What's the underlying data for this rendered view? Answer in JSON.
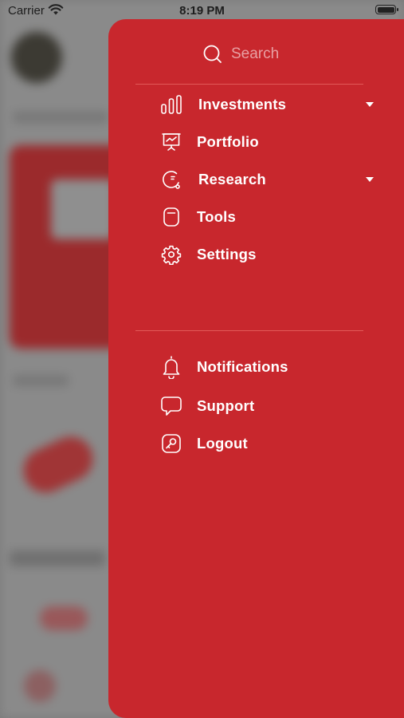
{
  "status_bar": {
    "carrier": "Carrier",
    "time": "8:19 PM"
  },
  "drawer": {
    "search": {
      "placeholder": "Search"
    },
    "menu": [
      {
        "label": "Investments",
        "icon": "bar-chart-icon",
        "expandable": true
      },
      {
        "label": "Portfolio",
        "icon": "presentation-icon",
        "expandable": false
      },
      {
        "label": "Research",
        "icon": "research-icon",
        "expandable": true
      },
      {
        "label": "Tools",
        "icon": "tools-icon",
        "expandable": false
      },
      {
        "label": "Settings",
        "icon": "gear-icon",
        "expandable": false
      }
    ],
    "secondary": [
      {
        "label": "Notifications",
        "icon": "bell-icon"
      },
      {
        "label": "Support",
        "icon": "chat-bubble-icon"
      },
      {
        "label": "Logout",
        "icon": "logout-icon"
      }
    ]
  },
  "colors": {
    "drawer_bg": "#c8272d",
    "text": "#ffffff",
    "divider": "#e25a58"
  }
}
